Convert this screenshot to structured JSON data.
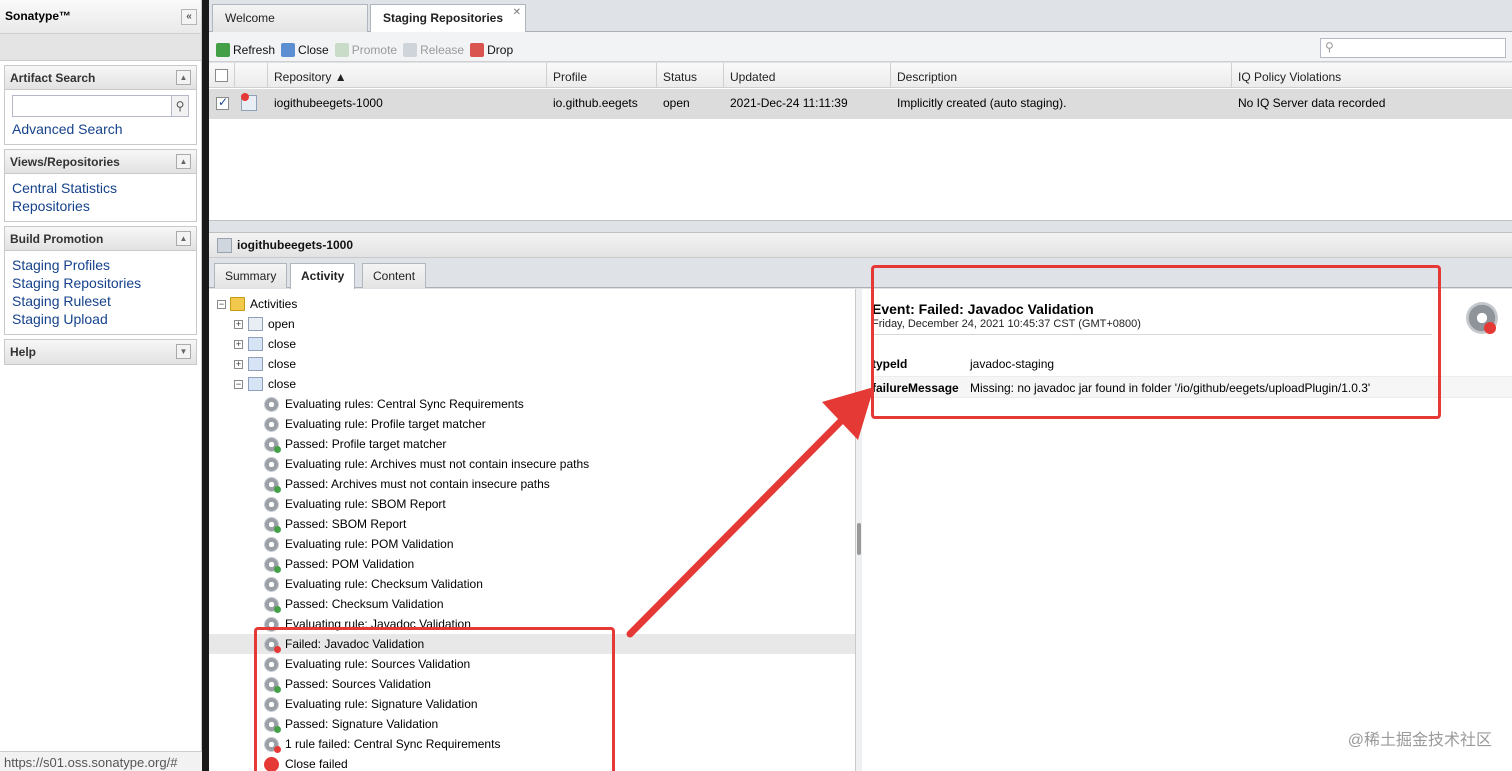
{
  "sidebar": {
    "brand": "Sonatype™",
    "collapse_glyph": "«",
    "panels": {
      "artifact_search": {
        "title": "Artifact Search",
        "search_placeholder": "",
        "advanced": "Advanced Search"
      },
      "views": {
        "title": "Views/Repositories",
        "links": [
          "Central Statistics",
          "Repositories"
        ]
      },
      "build": {
        "title": "Build Promotion",
        "links": [
          "Staging Profiles",
          "Staging Repositories",
          "Staging Ruleset",
          "Staging Upload"
        ]
      },
      "help": {
        "title": "Help"
      }
    },
    "status_url": "https://s01.oss.sonatype.org/#"
  },
  "tabs": {
    "welcome": "Welcome",
    "staging": "Staging Repositories"
  },
  "toolbar": {
    "refresh": "Refresh",
    "close": "Close",
    "promote": "Promote",
    "release": "Release",
    "drop": "Drop",
    "search_placeholder": ""
  },
  "grid": {
    "headers": {
      "repository": "Repository ▲",
      "profile": "Profile",
      "status": "Status",
      "updated": "Updated",
      "description": "Description",
      "iq": "IQ Policy Violations"
    },
    "row": {
      "repository": "iogithubeegets-1000",
      "profile": "io.github.eegets",
      "status": "open",
      "updated": "2021-Dec-24 11:11:39",
      "description": "Implicitly created (auto staging).",
      "iq": "No IQ Server data recorded"
    }
  },
  "detail": {
    "title": "iogithubeegets-1000",
    "tabs": {
      "summary": "Summary",
      "activity": "Activity",
      "content": "Content"
    }
  },
  "tree": {
    "root": "Activities",
    "groups": [
      "open",
      "close",
      "close",
      "close"
    ],
    "items": [
      "Evaluating rules: Central Sync Requirements",
      "Evaluating rule: Profile target matcher",
      "Passed: Profile target matcher",
      "Evaluating rule: Archives must not contain insecure paths",
      "Passed: Archives must not contain insecure paths",
      "Evaluating rule: SBOM Report",
      "Passed: SBOM Report",
      "Evaluating rule: POM Validation",
      "Passed: POM Validation",
      "Evaluating rule: Checksum Validation",
      "Passed: Checksum Validation",
      "Evaluating rule: Javadoc Validation",
      "Failed: Javadoc Validation",
      "Evaluating rule: Sources Validation",
      "Passed: Sources Validation",
      "Evaluating rule: Signature Validation",
      "Passed: Signature Validation",
      "1 rule failed: Central Sync Requirements",
      "Close failed"
    ]
  },
  "event": {
    "title": "Event: Failed: Javadoc Validation",
    "timestamp": "Friday, December 24, 2021 10:45:37 CST (GMT+0800)",
    "props": [
      {
        "key": "typeId",
        "value": "javadoc-staging"
      },
      {
        "key": "failureMessage",
        "value": "Missing: no javadoc jar found in folder '/io/github/eegets/uploadPlugin/1.0.3'"
      }
    ]
  },
  "watermark": "@稀土掘金技术社区",
  "colors": {
    "annotation": "#e53935",
    "link": "#15428b",
    "passed": "#43a047",
    "failed": "#e53935"
  }
}
